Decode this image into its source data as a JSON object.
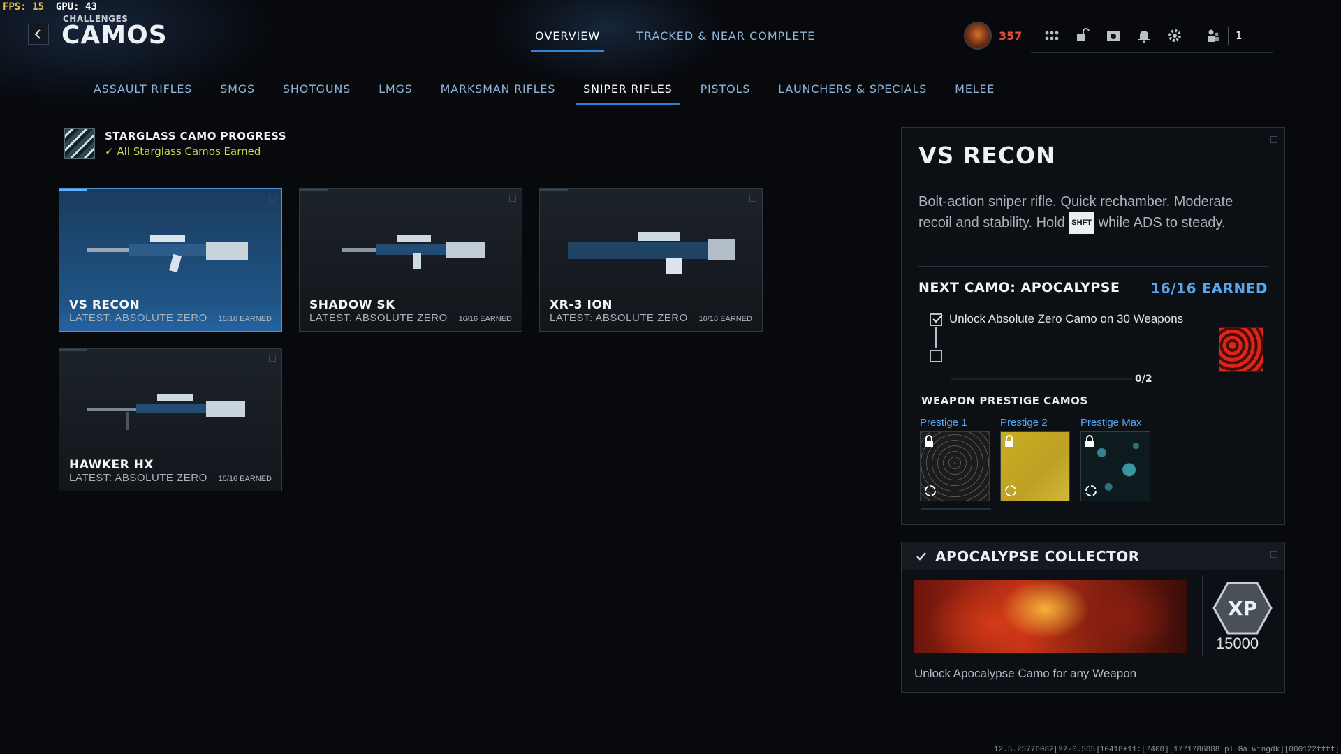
{
  "debug": {
    "fps_label": "FPS:",
    "fps_value": "15",
    "gpu_label": "GPU:",
    "gpu_value": "43"
  },
  "header": {
    "breadcrumb": "CHALLENGES",
    "title": "CAMOS"
  },
  "top_tabs": [
    {
      "label": "OVERVIEW",
      "active": true
    },
    {
      "label": "TRACKED & NEAR COMPLETE",
      "active": false
    }
  ],
  "hud": {
    "points": "357",
    "party_count": "1",
    "points_color": "#e14e3a"
  },
  "categories": [
    {
      "label": "ASSAULT RIFLES"
    },
    {
      "label": "SMGS"
    },
    {
      "label": "SHOTGUNS"
    },
    {
      "label": "LMGS"
    },
    {
      "label": "MARKSMAN RIFLES"
    },
    {
      "label": "SNIPER RIFLES",
      "active": true
    },
    {
      "label": "PISTOLS"
    },
    {
      "label": "LAUNCHERS & SPECIALS"
    },
    {
      "label": "MELEE"
    }
  ],
  "progress": {
    "title": "STARGLASS CAMO PROGRESS",
    "status": "All Starglass Camos Earned"
  },
  "weapons": [
    {
      "name": "VS RECON",
      "latest": "LATEST: ABSOLUTE ZERO",
      "earned": "16/16 EARNED",
      "selected": true
    },
    {
      "name": "SHADOW SK",
      "latest": "LATEST: ABSOLUTE ZERO",
      "earned": "16/16 EARNED",
      "selected": false
    },
    {
      "name": "XR-3 ION",
      "latest": "LATEST: ABSOLUTE ZERO",
      "earned": "16/16 EARNED",
      "selected": false
    },
    {
      "name": "HAWKER HX",
      "latest": "LATEST: ABSOLUTE ZERO",
      "earned": "16/16 EARNED",
      "selected": false
    }
  ],
  "detail": {
    "title": "VS RECON",
    "desc_part1": "Bolt-action sniper rifle.  Quick rechamber. Moderate recoil and stability.  Hold ",
    "desc_key": "SHFT",
    "desc_part2": " while ADS to steady.",
    "next_camo_label": "NEXT CAMO: APOCALYPSE",
    "next_camo_earned": "16/16 EARNED",
    "challenge_text": "Unlock Absolute Zero Camo on 30 Weapons",
    "challenge_progress": "0/2",
    "prestige_heading": "WEAPON PRESTIGE CAMOS",
    "prestige": [
      {
        "label": "Prestige 1",
        "style": "web"
      },
      {
        "label": "Prestige 2",
        "style": "gold"
      },
      {
        "label": "Prestige Max",
        "style": "stars"
      }
    ]
  },
  "collector": {
    "title": "APOCALYPSE COLLECTOR",
    "xp": "15000",
    "xp_badge": "XP",
    "description": "Unlock Apocalypse Camo for any Weapon"
  },
  "footer": {
    "version": "12.5.25776082[92-0.565]10418+11:[7400][1771786888.pl.Ga.wingdk][000122ffff]"
  },
  "colors": {
    "accent": "#2f86d8",
    "accent_text": "#58a6ee",
    "earned_green": "#c6d94a"
  }
}
